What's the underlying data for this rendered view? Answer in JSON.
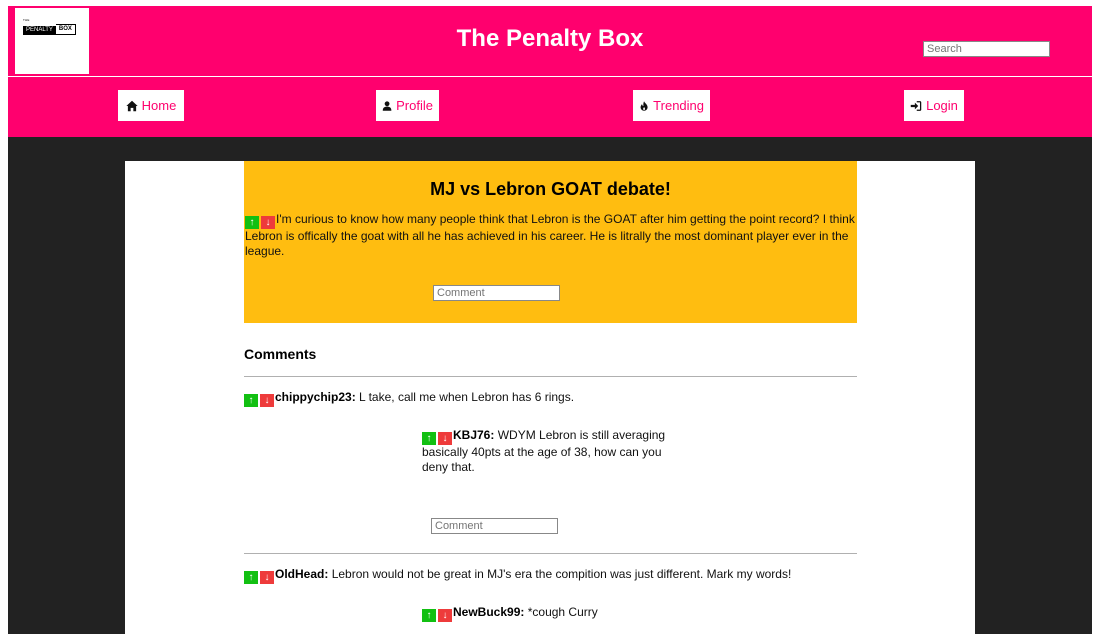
{
  "logo": {
    "top_text": "THE",
    "penalty": "PENALTY",
    "box": "BOX"
  },
  "site_title": "The Penalty Box",
  "search": {
    "placeholder": "Search"
  },
  "nav": {
    "home": "Home",
    "profile": "Profile",
    "trending": "Trending",
    "login": "Login"
  },
  "post": {
    "title": "MJ vs Lebron GOAT debate!",
    "body": "I'm curious to know how many people think that Lebron is the GOAT after him getting the point record? I think Lebron is offically the goat with all he has achieved in his career. He is litrally the most dominant player ever in the league.",
    "comment_placeholder": "Comment"
  },
  "vote": {
    "up": "↑",
    "down": "↓"
  },
  "comments_heading": "Comments",
  "comments": [
    {
      "author": "chippychip23:",
      "text": "L take, call me when Lebron has 6 rings.",
      "replies": [
        {
          "author": "KBJ76:",
          "text": "WDYM Lebron is still averaging basically 40pts at the age of 38, how can you deny that."
        }
      ],
      "reply_placeholder": "Comment"
    },
    {
      "author": "OldHead:",
      "text": "Lebron would not be great in MJ's era the compition was just different. Mark my words!",
      "replies": [
        {
          "author": "NewBuck99:",
          "text": "*cough Curry"
        }
      ]
    }
  ],
  "colors": {
    "brand": "#ff006e",
    "post_bg": "#ffbd10",
    "upvote": "#12c012",
    "downvote": "#ee3b3b",
    "page_bg": "#222222"
  }
}
